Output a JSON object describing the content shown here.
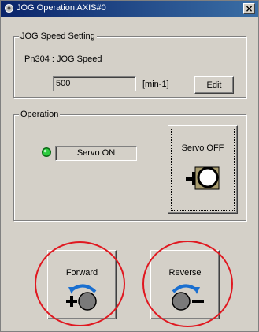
{
  "window": {
    "title": "JOG Operation AXIS#0",
    "close_glyph": "×"
  },
  "speed_group": {
    "legend": "JOG Speed Setting",
    "param_label": "Pn304 : JOG Speed",
    "speed_value": "500",
    "unit": "[min-1]",
    "edit_label": "Edit"
  },
  "operation_group": {
    "legend": "Operation",
    "status_text": "Servo ON",
    "status_led_color": "#2ecc40",
    "servo_button_label": "Servo OFF",
    "servo_icon": "servo-motor-icon"
  },
  "jog_buttons": {
    "forward_label": "Forward",
    "forward_icon": "forward-rotation-icon",
    "reverse_label": "Reverse",
    "reverse_icon": "reverse-rotation-icon"
  },
  "annotations": {
    "highlight_color": "#e01820"
  }
}
